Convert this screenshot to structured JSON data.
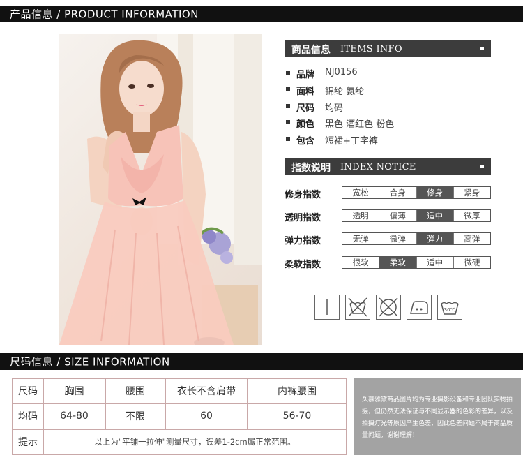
{
  "top_banner": {
    "text": "产品信息 / PRODUCT INFORMATION"
  },
  "items_info": {
    "title_cn": "商品信息",
    "title_en": "ITEMS INFO",
    "rows": [
      {
        "label": "品牌",
        "value": "NJ0156"
      },
      {
        "label": "面料",
        "value": "锦纶 氨纶"
      },
      {
        "label": "尺码",
        "value": "均码"
      },
      {
        "label": "颜色",
        "value": "黑色  酒红色  粉色"
      },
      {
        "label": "包含",
        "value": "短裙+丁字裤"
      }
    ]
  },
  "index_notice": {
    "title_cn": "指数说明",
    "title_en": "INDEX NOTICE",
    "rows": [
      {
        "label": "修身指数",
        "options": [
          "宽松",
          "合身",
          "修身",
          "紧身"
        ],
        "selected_index": 2
      },
      {
        "label": "透明指数",
        "options": [
          "透明",
          "偏薄",
          "适中",
          "微厚"
        ],
        "selected_index": 2
      },
      {
        "label": "弹力指数",
        "options": [
          "无弹",
          "微弹",
          "弹力",
          "高弹"
        ],
        "selected_index": 2
      },
      {
        "label": "柔软指数",
        "options": [
          "很软",
          "柔软",
          "适中",
          "微硬"
        ],
        "selected_index": 1
      }
    ]
  },
  "care_icons": [
    "no-bleach-icon",
    "no-hand-wash-icon",
    "no-tumble-dry-icon",
    "no-iron-icon",
    "wash-30c-icon"
  ],
  "care_temp": "30℃",
  "size_banner": {
    "text": "尺码信息 / SIZE INFORMATION"
  },
  "size_table": {
    "headers": [
      "尺码",
      "胸围",
      "腰围",
      "衣长不含肩带",
      "内裤腰围"
    ],
    "row": [
      "均码",
      "64-80",
      "不限",
      "60",
      "56-70"
    ],
    "note_label": "提示",
    "note": "以上为\"平铺一拉伸\"测量尺寸，误差1-2cm属正常范围。"
  },
  "notice_text": "久慕雅黛商品图片均为专业摄影设备和专业团队实物拍摄，但仍然无法保证与不同显示器的色彩的差异，以及拍摄灯光等原因产生色差，因此色差问题不属于商品质量问题，谢谢理解！",
  "colors": {
    "band_bg": "#111111",
    "section_head_bg": "#3c3c3c",
    "selected_cell_bg": "#555555",
    "table_border": "#c9a8a8",
    "notice_bg": "#a3a3a3"
  }
}
